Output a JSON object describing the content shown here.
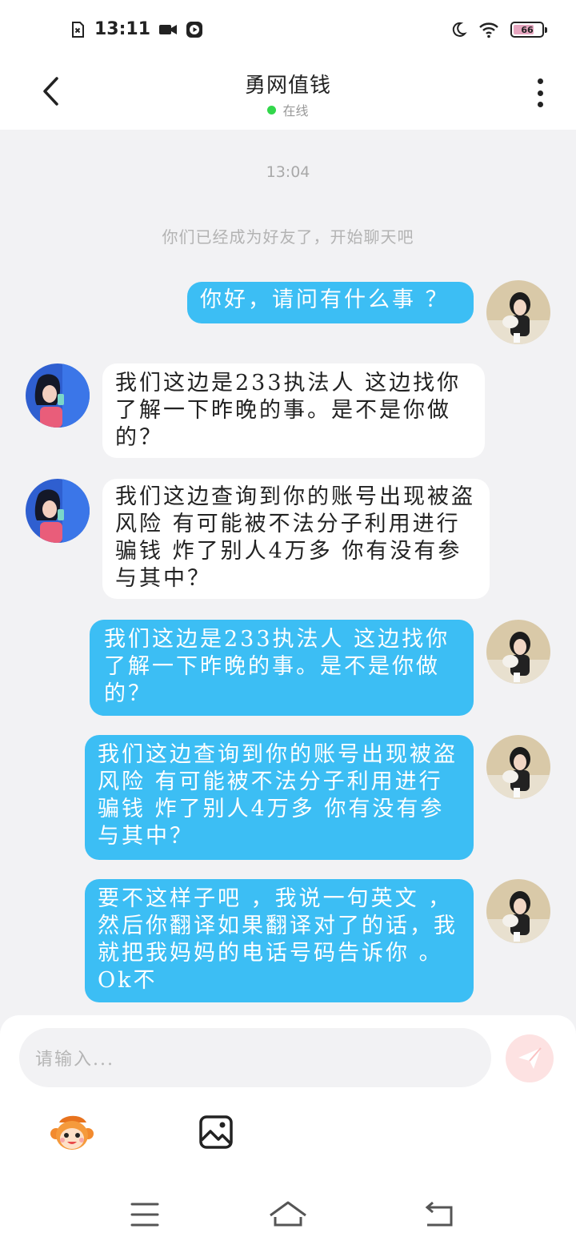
{
  "status_bar": {
    "time": "13:11",
    "battery_level": "66",
    "icons": [
      "sim-error-icon",
      "video-record-icon",
      "play-icon",
      "moon-icon",
      "wifi-icon",
      "battery-icon"
    ]
  },
  "header": {
    "title": "勇网值钱",
    "status": "在线",
    "status_color": "#32d74b"
  },
  "chat": {
    "timestamp": "13:04",
    "system_message": "你们已经成为好友了，开始聊天吧",
    "messages": [
      {
        "side": "right",
        "text": "你好，请问有什么事 ？"
      },
      {
        "side": "left",
        "text": "我们这边是233执法人 这边找你了解一下昨晚的事。是不是你做的？"
      },
      {
        "side": "left",
        "text": "我们这边查询到你的账号出现被盗风险 有可能被不法分子利用进行骗钱 炸了别人4万多 你有没有参与其中？"
      },
      {
        "side": "right",
        "text": "我们这边是233执法人 这边找你了解一下昨晚的事。是不是你做的？"
      },
      {
        "side": "right",
        "text": "我们这边查询到你的账号出现被盗风险 有可能被不法分子利用进行骗钱 炸了别人4万多 你有没有参与其中？"
      },
      {
        "side": "right",
        "text": "要不这样子吧 ，我说一句英文 ，然后你翻译如果翻译对了的话，我就把我妈妈的电话号码告诉你 。Ok不"
      }
    ]
  },
  "input": {
    "placeholder": "请输入..."
  },
  "colors": {
    "accent_bubble": "#3cbef4",
    "background": "#f2f2f4",
    "send_button": "#fde2e2"
  }
}
